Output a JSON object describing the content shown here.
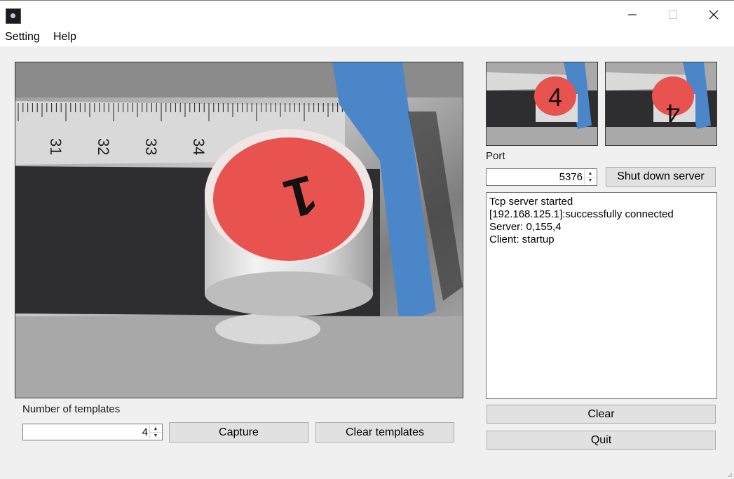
{
  "window": {
    "icon": "app-icon",
    "controls": [
      "minimize-icon",
      "maximize-icon",
      "close-icon"
    ]
  },
  "menu": {
    "items": [
      {
        "label": "Setting"
      },
      {
        "label": "Help"
      }
    ]
  },
  "camera": {
    "ruler_ticks": [
      "31",
      "32",
      "33",
      "34"
    ],
    "part_mark": "1"
  },
  "templates": {
    "thumbs": [
      {
        "mark": "4"
      },
      {
        "mark": "4"
      }
    ],
    "count_label": "Number of templates",
    "count_value": "4",
    "capture_label": "Capture",
    "clear_label": "Clear templates"
  },
  "server": {
    "port_label": "Port",
    "port_value": "5376",
    "shutdown_label": "Shut down server"
  },
  "log": {
    "lines": [
      "Tcp server started",
      "[192.168.125.1]:successfully connected",
      "Server: 0,155,4",
      "Client: startup"
    ]
  },
  "actions": {
    "clear_label": "Clear",
    "quit_label": "Quit"
  },
  "colors": {
    "part_red": "#e8524f",
    "blue_clamp": "#4a86c8",
    "belt": "#2e2e30"
  }
}
